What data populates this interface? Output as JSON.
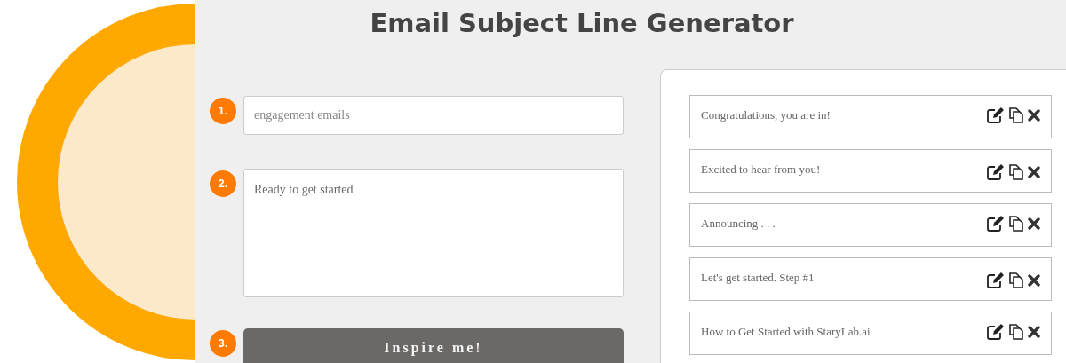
{
  "title": "Email Subject Line Generator",
  "steps": [
    {
      "number": "1.",
      "kind": "input",
      "placeholder": "engagement emails"
    },
    {
      "number": "2.",
      "kind": "textarea",
      "value": "Ready to get started"
    },
    {
      "number": "3.",
      "kind": "button",
      "label": "Inspire me!"
    }
  ],
  "results": [
    {
      "text": "Congratulations, you are in!"
    },
    {
      "text": "Excited to hear from you!"
    },
    {
      "text": "Announcing . . ."
    },
    {
      "text": "Let's get started. Step #1"
    },
    {
      "text": "How to Get Started with StaryLab.ai"
    }
  ]
}
